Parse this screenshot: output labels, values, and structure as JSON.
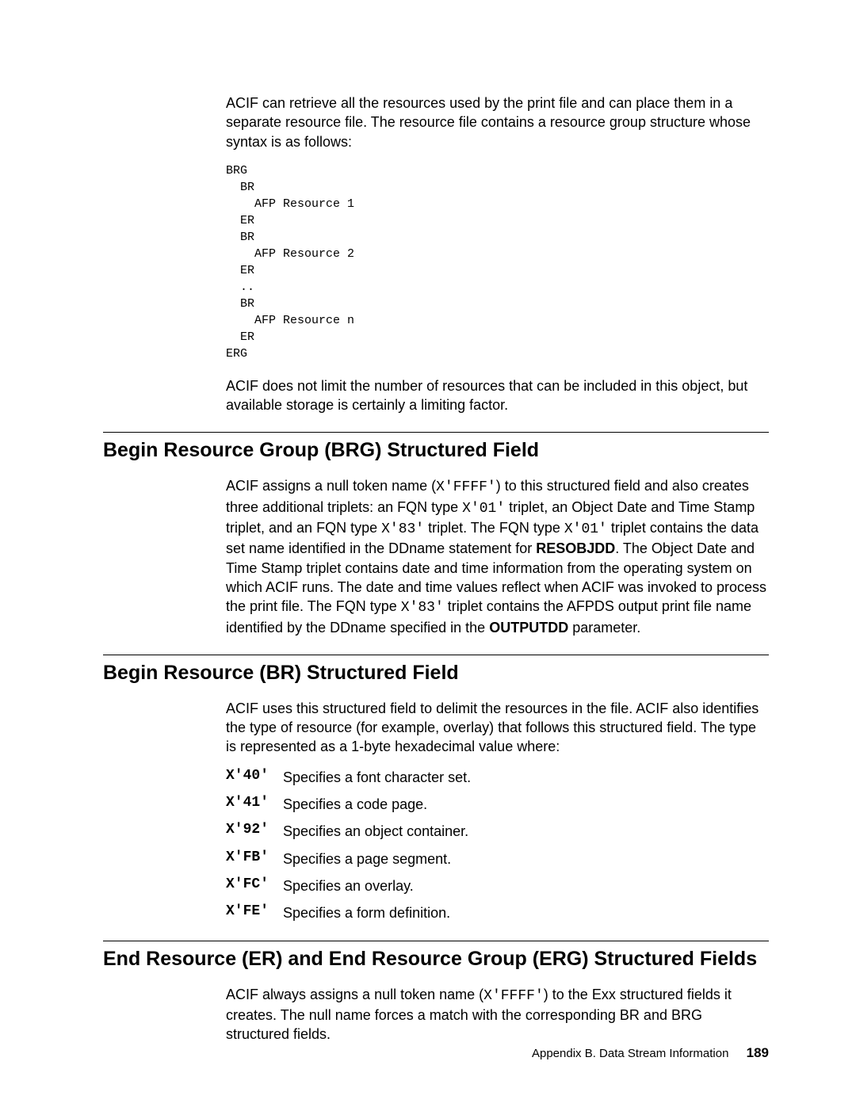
{
  "intro": {
    "p1_a": "ACIF can retrieve all the resources used by the print file and can place them in a separate resource file. The resource file contains a resource group structure whose syntax is as follows:",
    "code": "BRG\n  BR\n    AFP Resource 1\n  ER\n  BR\n    AFP Resource 2\n  ER\n  ..\n  BR\n    AFP Resource n\n  ER\nERG",
    "p2": "ACIF does not limit the number of resources that can be included in this object, but available storage is certainly a limiting factor."
  },
  "section1": {
    "heading": "Begin Resource Group (BRG) Structured Field",
    "para_pre": "ACIF assigns a null token name (",
    "para_token": "X'FFFF'",
    "para_mid1": ") to this structured field and also creates three additional triplets: an FQN type ",
    "t01a": "X'01'",
    "para_mid2": " triplet, an Object Date and Time Stamp triplet, and an FQN type ",
    "t83": "X'83'",
    "para_mid3": " triplet. The FQN type ",
    "t01b": "X'01'",
    "para_mid4": " triplet contains the data set name identified in the DDname statement for ",
    "resobjdd": "RESOBJDD",
    "para_mid5": ". The Object Date and Time Stamp triplet contains date and time information from the operating system on which ACIF runs. The date and time values reflect when ACIF was invoked to process the print file. The FQN type ",
    "t83b": "X'83'",
    "para_mid6": " triplet contains the AFPDS output print file name identified by the DDname specified in the ",
    "outputdd": "OUTPUTDD",
    "para_end": " parameter."
  },
  "section2": {
    "heading": "Begin Resource (BR) Structured Field",
    "para": "ACIF uses this structured field to delimit the resources in the file. ACIF also identifies the type of resource (for example, overlay) that follows this structured field. The type is represented as a 1-byte hexadecimal value where:",
    "defs": [
      {
        "term": "X'40'",
        "desc": "Specifies a font character set."
      },
      {
        "term": "X'41'",
        "desc": "Specifies a code page."
      },
      {
        "term": "X'92'",
        "desc": "Specifies an object container."
      },
      {
        "term": "X'FB'",
        "desc": "Specifies a page segment."
      },
      {
        "term": "X'FC'",
        "desc": "Specifies an overlay."
      },
      {
        "term": "X'FE'",
        "desc": "Specifies a form definition."
      }
    ]
  },
  "section3": {
    "heading": "End Resource (ER) and End Resource Group (ERG) Structured Fields",
    "para_pre": "ACIF always assigns a null token name (",
    "para_token": "X'FFFF'",
    "para_end": ") to the Exx structured fields it creates. The null name forces a match with the corresponding BR and BRG structured fields."
  },
  "footer": {
    "label": "Appendix B.  Data Stream Information",
    "page": "189"
  }
}
